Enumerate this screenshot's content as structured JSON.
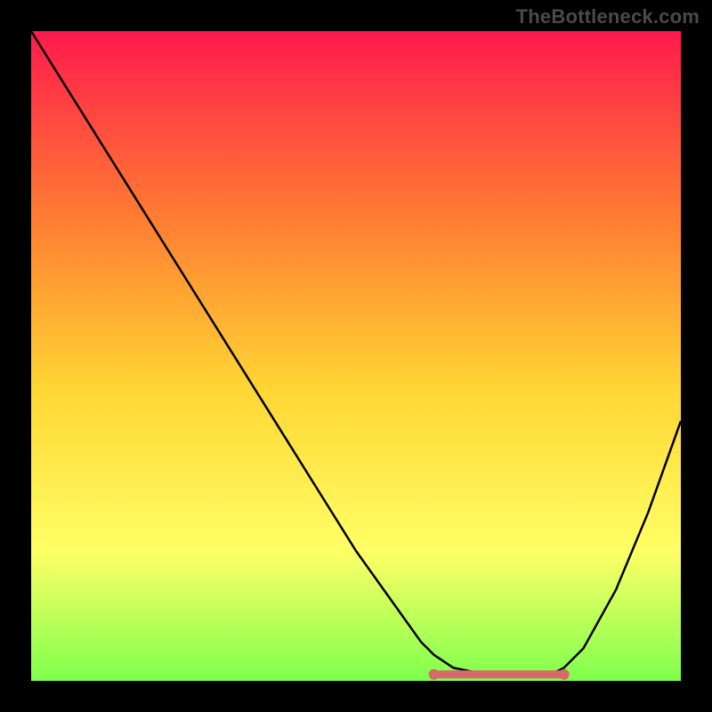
{
  "watermark": {
    "text": "TheBottleneck.com"
  },
  "colors": {
    "grad_top": "#ff1a4d",
    "grad_mid1": "#ff7a33",
    "grad_mid2": "#ffd633",
    "grad_mid3": "#ffff66",
    "grad_bottom": "#7fff4d",
    "curve": "#000000",
    "optimal_stroke": "#d46a6a",
    "optimal_dot": "#d46a6a",
    "frame": "#000000"
  },
  "chart_data": {
    "type": "line",
    "title": "",
    "xlabel": "",
    "ylabel": "",
    "xlim": [
      0,
      100
    ],
    "ylim": [
      0,
      100
    ],
    "grid": false,
    "legend": false,
    "x": [
      0,
      5,
      10,
      15,
      20,
      25,
      30,
      35,
      40,
      45,
      50,
      55,
      60,
      62,
      65,
      70,
      75,
      80,
      82,
      85,
      90,
      95,
      100
    ],
    "values": [
      100,
      92,
      84,
      76,
      68,
      60,
      52,
      44,
      36,
      28,
      20,
      13,
      6,
      4,
      2,
      1,
      1,
      1,
      2,
      5,
      14,
      26,
      40
    ],
    "optimal_range_x": [
      62,
      82
    ],
    "optimal_range_y": 1
  },
  "geometry": {
    "inner_left": 35,
    "inner_top": 35,
    "inner_width": 730,
    "inner_height": 730
  }
}
